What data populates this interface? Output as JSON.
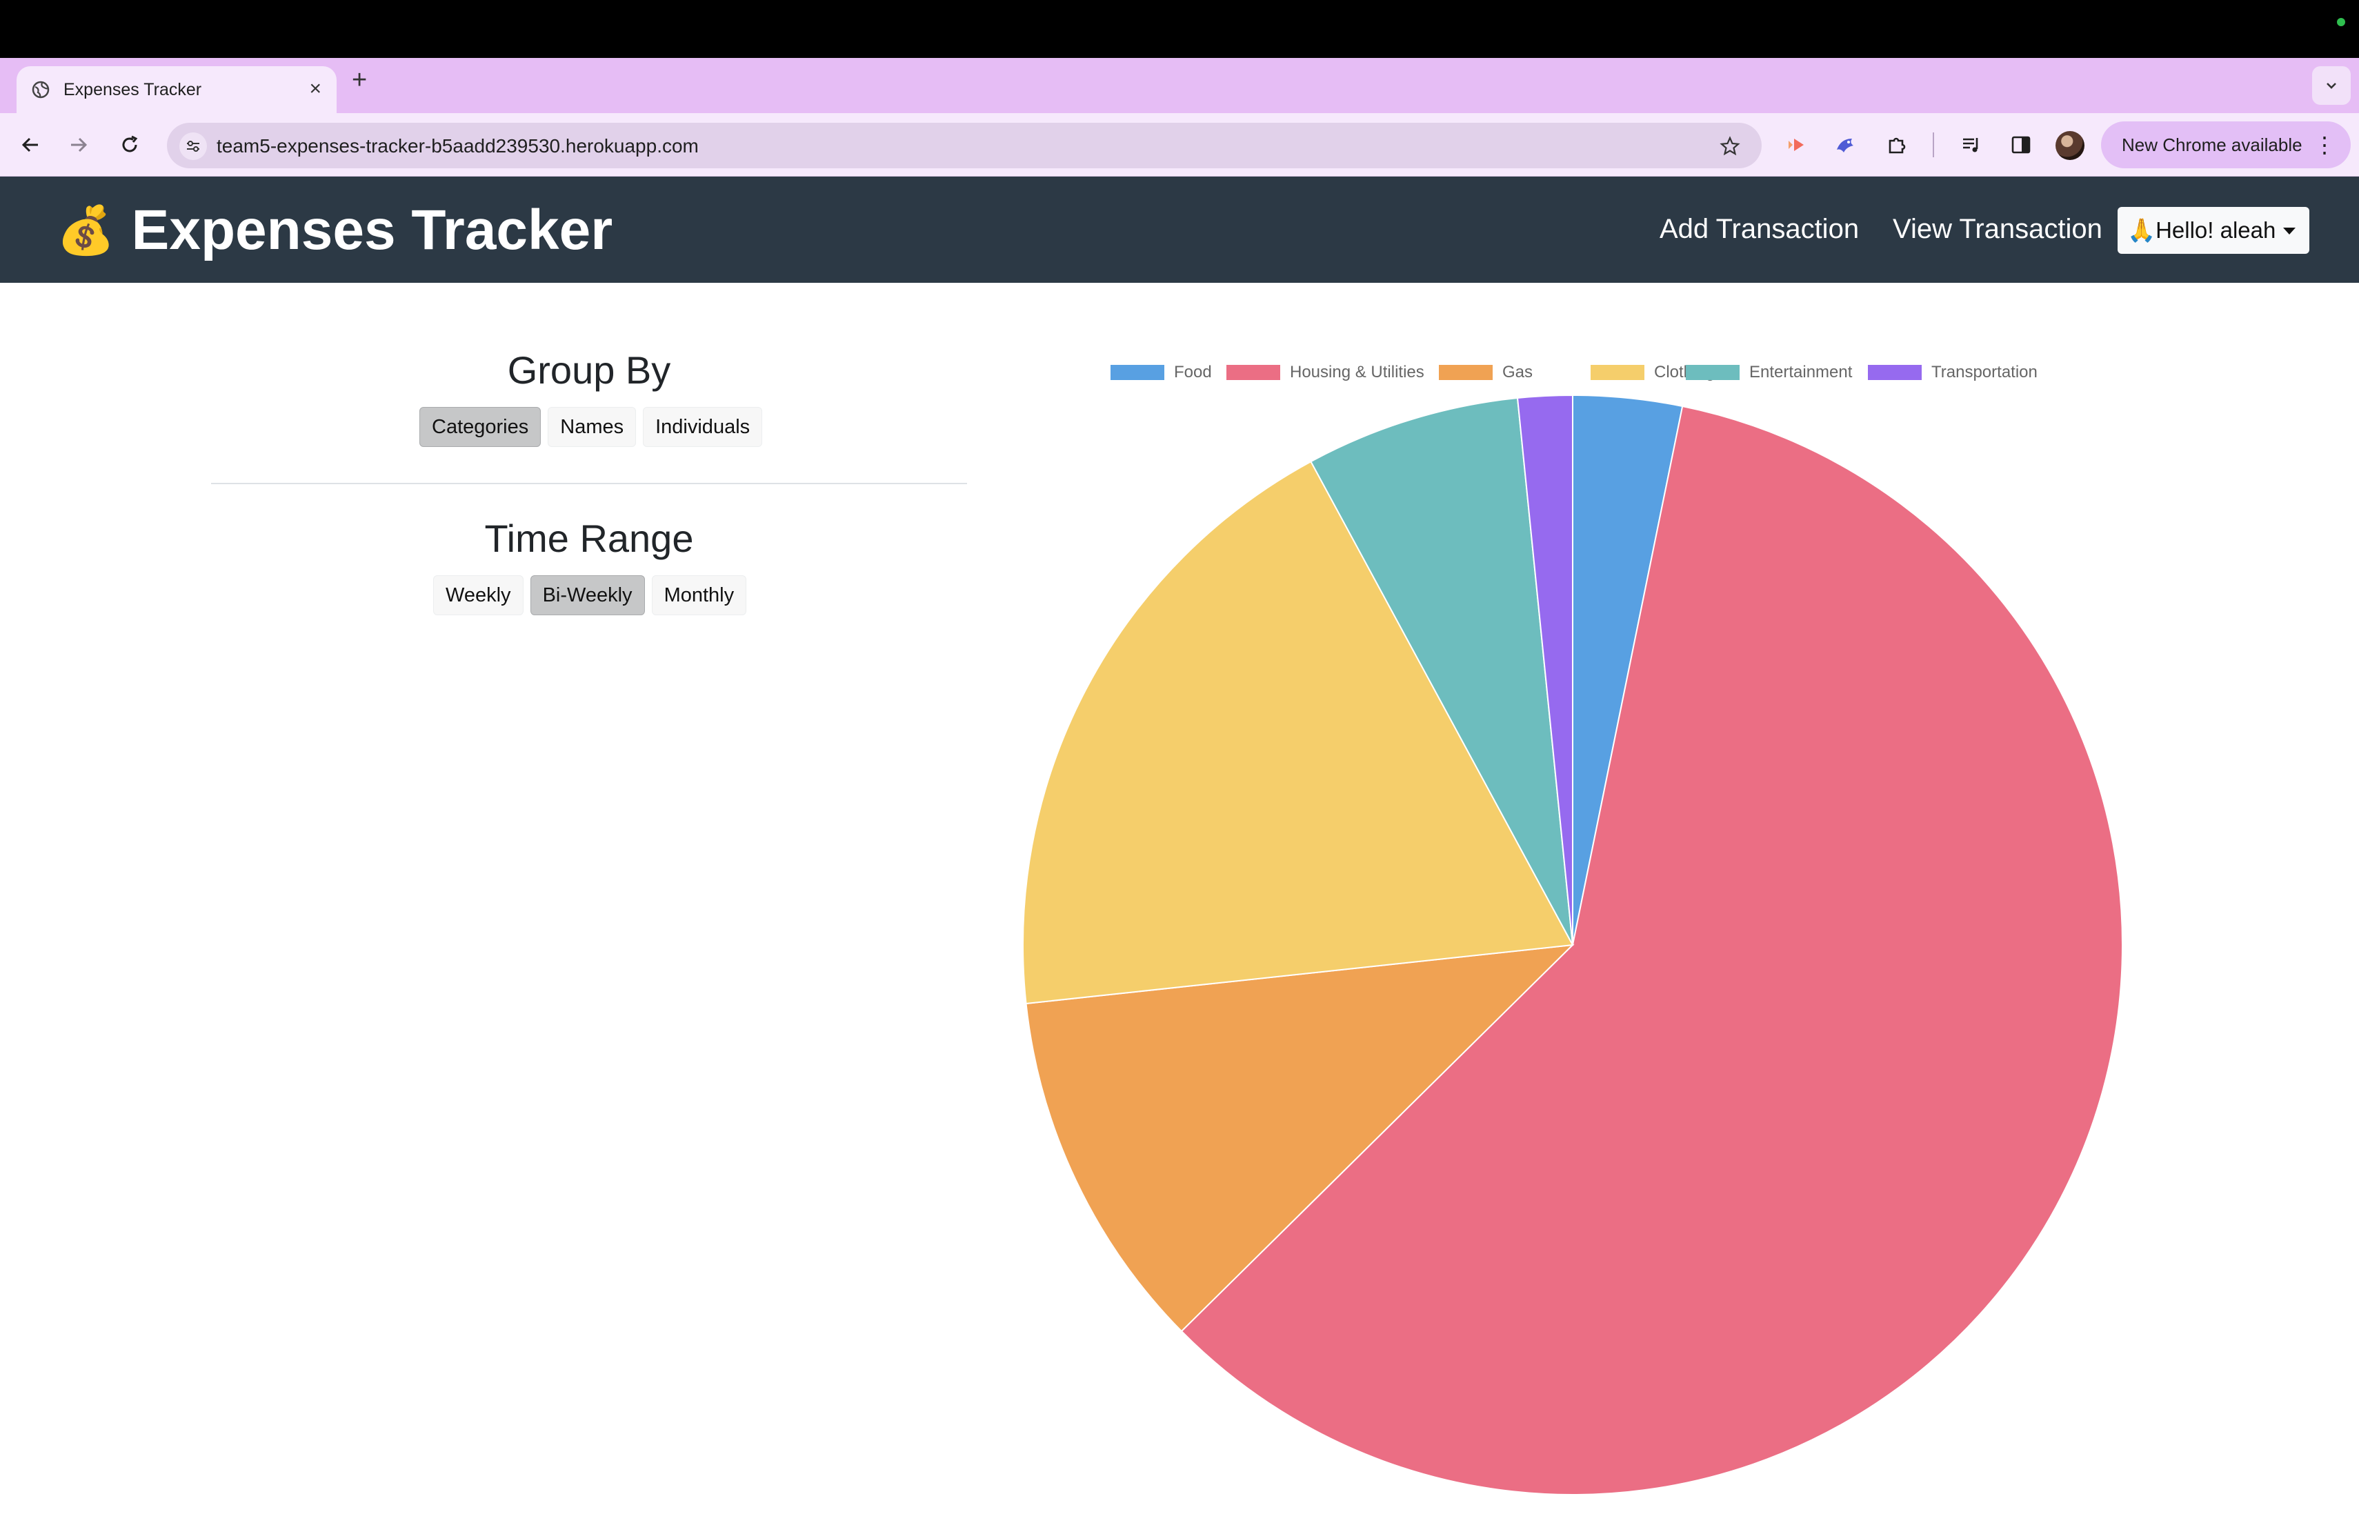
{
  "browser": {
    "tab_title": "Expenses Tracker",
    "new_tab_symbol": "+",
    "close_symbol": "×",
    "url": "team5-expenses-tracker-b5aadd239530.herokuapp.com",
    "update_label": "New Chrome available",
    "update_menu_symbol": "⋮"
  },
  "navbar": {
    "brand_emoji": "💰",
    "brand_title": "Expenses Tracker",
    "add_transaction": "Add Transaction",
    "view_transaction": "View Transaction",
    "user_greeting": "🙏Hello! aleah"
  },
  "group_by": {
    "title": "Group By",
    "options": [
      "Categories",
      "Names",
      "Individuals"
    ],
    "selected": "Categories"
  },
  "time_range": {
    "title": "Time Range",
    "options": [
      "Weekly",
      "Bi-Weekly",
      "Monthly"
    ],
    "selected": "Bi-Weekly"
  },
  "colors": {
    "navbar_bg": "#2c3945",
    "tabstrip_bg": "#e6bdf5"
  },
  "chart_data": {
    "type": "pie",
    "title": "",
    "legend_position": "top",
    "categories": [
      "Food",
      "Housing & Utilities",
      "Gas",
      "Clothing",
      "Entertainment",
      "Transportation"
    ],
    "values": [
      3.2,
      59.4,
      10.7,
      18.8,
      6.3,
      1.6
    ],
    "colors": [
      "#58a0e2",
      "#eb6e84",
      "#f0a253",
      "#f5ce6b",
      "#6dbdbe",
      "#966aef"
    ]
  }
}
